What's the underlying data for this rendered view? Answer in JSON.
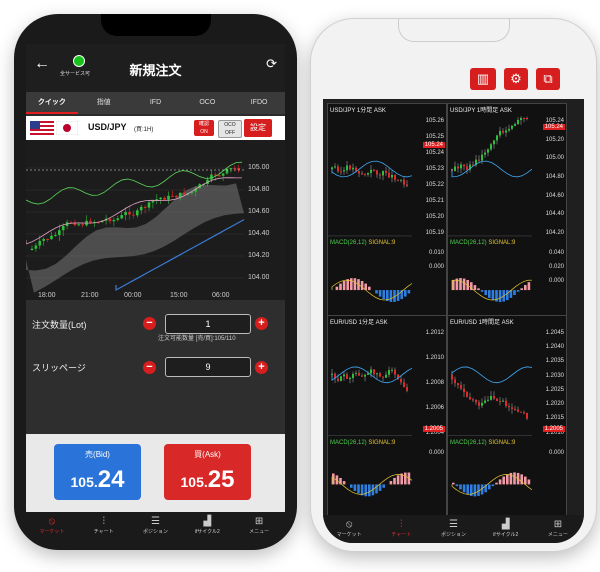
{
  "left": {
    "header": {
      "title": "新規注文",
      "status_label": "全サービス可"
    },
    "tabs": [
      {
        "label": "クイック",
        "active": true
      },
      {
        "label": "指値"
      },
      {
        "label": "IFD"
      },
      {
        "label": "OCO"
      },
      {
        "label": "IFDO"
      }
    ],
    "symbol": {
      "pair": "USD/JPY",
      "timeframe": "(買:1H)",
      "btn1": "確認\nON",
      "btn2": "OCO\nOFF",
      "settings": "設定"
    },
    "chart": {
      "y_labels": [
        "105.00",
        "104.80",
        "104.60",
        "104.40",
        "104.20",
        "104.00"
      ],
      "x_labels": [
        "18:00",
        "21:00",
        "00:00",
        "15:00",
        "06:00"
      ]
    },
    "form": {
      "lot_label": "注文数量(Lot)",
      "lot_value": "1",
      "lot_note": "注文可能数量 [売/買]:105/110",
      "slip_label": "スリッページ",
      "slip_value": "9"
    },
    "trade": {
      "bid_label": "売(Bid)",
      "bid_int": "105.",
      "bid_dec": "24",
      "ask_label": "買(Ask)",
      "ask_int": "105.",
      "ask_dec": "25"
    },
    "nav": [
      {
        "label": "マーケット",
        "icon": "swoosh",
        "active": true
      },
      {
        "label": "チャート",
        "icon": "candles"
      },
      {
        "label": "ポジション",
        "icon": "list"
      },
      {
        "label": "ifサイクル2",
        "icon": "bars"
      },
      {
        "label": "メニュー",
        "icon": "grid"
      }
    ]
  },
  "right": {
    "panels": [
      {
        "title": "USD/JPY 1分足 ASK",
        "y": [
          "105.26",
          "105.25",
          "105.24",
          "105.23",
          "105.22",
          "105.21",
          "105.20",
          "105.19"
        ],
        "price": "105.24",
        "macd_y": [
          "0.010",
          "0.000"
        ],
        "x": [
          "16:06",
          "16:21"
        ],
        "macd": "MACD(26,12)",
        "signal": "SIGNAL:9"
      },
      {
        "title": "USD/JPY 1時間足 ASK",
        "y": [
          "105.24",
          "105.20",
          "105.00",
          "104.80",
          "104.60",
          "104.40",
          "104.20"
        ],
        "price": "105.24",
        "macd_y": [
          "0.040",
          "0.020",
          "0.000"
        ],
        "x": [
          "21:00",
          "12:00"
        ],
        "macd": "MACD(26,12)",
        "signal": "SIGNAL:9"
      },
      {
        "title": "EUR/USD 1分足 ASK",
        "y": [
          "1.2012",
          "1.2010",
          "1.2008",
          "1.2006",
          "1.2004"
        ],
        "price": "1.2005",
        "macd_y": [
          "0.000"
        ],
        "x": [
          "16:06",
          "16:21"
        ],
        "macd": "MACD(26,12)",
        "signal": "SIGNAL:9"
      },
      {
        "title": "EUR/USD 1時間足 ASK",
        "y": [
          "1.2045",
          "1.2040",
          "1.2035",
          "1.2030",
          "1.2025",
          "1.2020",
          "1.2015",
          "1.2010"
        ],
        "price": "1.2005",
        "macd_y": [
          "0.000"
        ],
        "x": [
          "21:00",
          "12:00"
        ],
        "macd": "MACD(26,12)",
        "signal": "SIGNAL:9"
      }
    ],
    "nav": [
      {
        "label": "マーケット",
        "icon": "swoosh"
      },
      {
        "label": "チャート",
        "icon": "candles",
        "active": true
      },
      {
        "label": "ポジション",
        "icon": "list"
      },
      {
        "label": "ifサイクル2",
        "icon": "bars"
      },
      {
        "label": "メニュー",
        "icon": "grid"
      }
    ]
  },
  "colors": {
    "accent": "#d61e1e",
    "bid": "#2a73d9",
    "ask": "#d92828",
    "up": "#2fbf3a",
    "down": "#e02a2a"
  }
}
